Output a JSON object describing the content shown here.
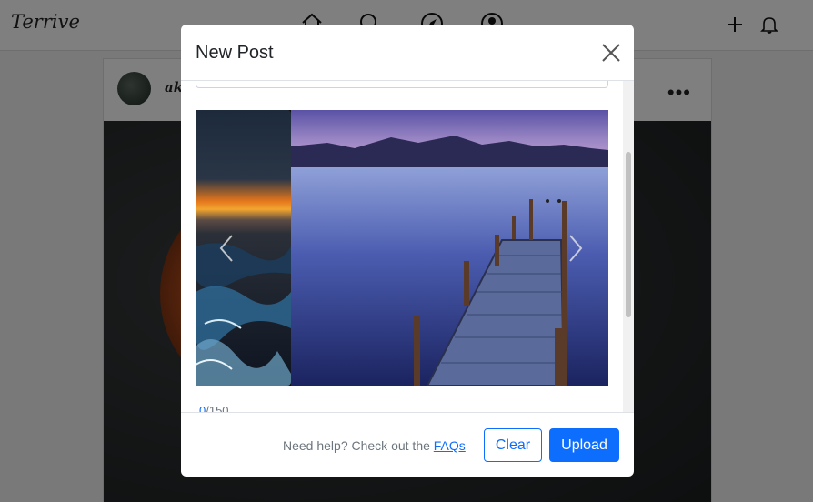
{
  "app": {
    "brand": "Terrive"
  },
  "navbar": {
    "icons": [
      "home-icon",
      "search-icon",
      "explore-icon",
      "profile-icon"
    ],
    "right_icons": [
      "plus-icon",
      "bell-icon"
    ]
  },
  "post": {
    "username": "akl",
    "more_label": "•••"
  },
  "modal": {
    "title": "New Post",
    "counter_current": "0",
    "counter_max": "/150",
    "help_text": "Need help? Check out the ",
    "help_link": "FAQs",
    "clear_label": "Clear",
    "upload_label": "Upload"
  },
  "colors": {
    "primary": "#0d6efd",
    "overlay": "rgba(0,0,0,0.5)"
  }
}
